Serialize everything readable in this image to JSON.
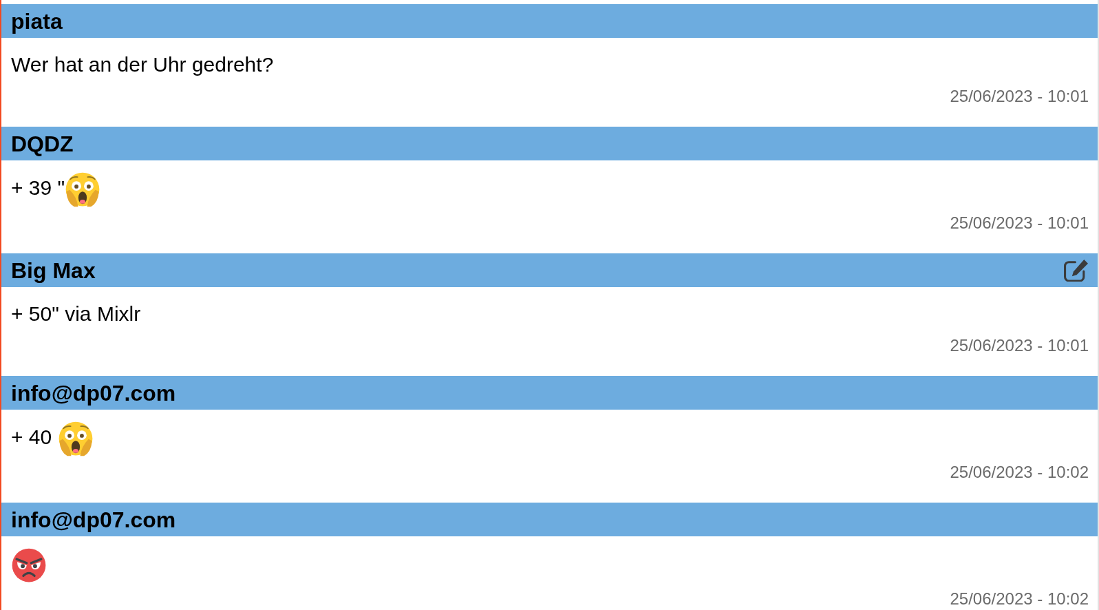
{
  "messages": [
    {
      "author": "piata",
      "editable": false,
      "content": [
        {
          "kind": "text",
          "text": "Wer hat an der Uhr gedreht?"
        }
      ],
      "timestamp": "25/06/2023 - 10:01"
    },
    {
      "author": "DQDZ",
      "editable": false,
      "content": [
        {
          "kind": "text",
          "text": "+ 39 \""
        },
        {
          "kind": "scream"
        }
      ],
      "timestamp": "25/06/2023 - 10:01"
    },
    {
      "author": "Big Max",
      "editable": true,
      "content": [
        {
          "kind": "text",
          "text": "+ 50\" via Mixlr"
        }
      ],
      "timestamp": "25/06/2023 - 10:01"
    },
    {
      "author": "info@dp07.com",
      "editable": false,
      "content": [
        {
          "kind": "text",
          "text": "+ 40 "
        },
        {
          "kind": "scream"
        }
      ],
      "timestamp": "25/06/2023 - 10:02"
    },
    {
      "author": "info@dp07.com",
      "editable": false,
      "content": [
        {
          "kind": "angry"
        }
      ],
      "timestamp": "25/06/2023 - 10:02"
    }
  ]
}
